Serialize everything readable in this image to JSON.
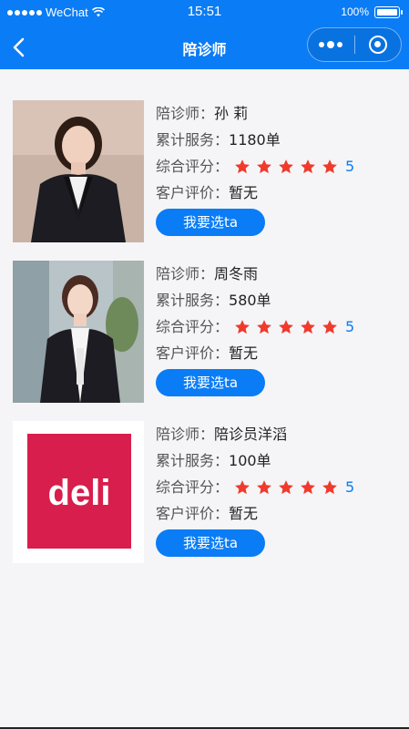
{
  "status_bar": {
    "carrier": "WeChat",
    "time": "15:51",
    "battery": "100%"
  },
  "nav": {
    "title": "陪诊师"
  },
  "companions": [
    {
      "name_label": "陪诊师：",
      "name": "孙 莉",
      "service_label": "累计服务：",
      "service": "1180单",
      "rating_label": "综合评分：",
      "stars": 5,
      "score": "5",
      "review_label": "客户评价：",
      "review": "暂无",
      "button": "我要选ta",
      "photo": "woman-suit-photo"
    },
    {
      "name_label": "陪诊师：",
      "name": "周冬雨",
      "service_label": "累计服务：",
      "service": "580单",
      "rating_label": "综合评分：",
      "stars": 5,
      "score": "5",
      "review_label": "客户评价：",
      "review": "暂无",
      "button": "我要选ta",
      "photo": "woman-uniform-photo"
    },
    {
      "name_label": "陪诊师：",
      "name": "陪诊员洋滔",
      "service_label": "累计服务：",
      "service": "100单",
      "rating_label": "综合评分：",
      "stars": 5,
      "score": "5",
      "review_label": "客户评价：",
      "review": "暂无",
      "button": "我要选ta",
      "photo": "deli-logo",
      "logo_text": "deli"
    }
  ],
  "colors": {
    "primary": "#0a7cf5",
    "star": "#f03a2c",
    "deli_red": "#d81e4c"
  }
}
